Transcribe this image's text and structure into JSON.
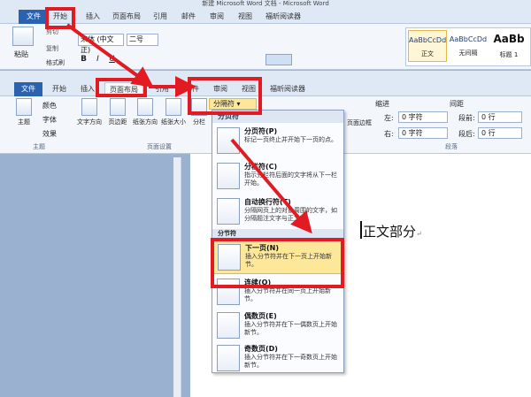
{
  "back_window": {
    "title": "新建 Microsoft Word 文档 - Microsoft Word",
    "tabs": [
      "文件",
      "开始",
      "插入",
      "页面布局",
      "引用",
      "邮件",
      "审阅",
      "视图",
      "福昕阅读器"
    ],
    "paste_label": "粘贴",
    "cut_label": "剪切",
    "copy_label": "复制",
    "format_painter_label": "格式刷",
    "font_name": "宋体 (中文正)",
    "font_size": "二号",
    "bold": "B",
    "italic": "I",
    "underline": "U",
    "styles": [
      {
        "preview": "AaBbCcDd",
        "name": "正文"
      },
      {
        "preview": "AaBbCcDd",
        "name": "无间隔"
      },
      {
        "preview": "AaBb",
        "name": "标题 1"
      }
    ]
  },
  "front_window": {
    "tabs": [
      "文件",
      "开始",
      "插入",
      "页面布局",
      "引用",
      "邮件",
      "审阅",
      "视图",
      "福昕阅读器"
    ],
    "ribbon": {
      "theme_group": "主题",
      "colors": "颜色",
      "fonts": "字体",
      "effects": "效果",
      "theme": "主题",
      "text_direction": "文字方向",
      "margins": "页边距",
      "orientation": "纸张方向",
      "size": "纸张大小",
      "columns": "分栏",
      "breaks_button": "分隔符",
      "page_setup_group": "页面设置",
      "page_border": "页面边框",
      "indent_label": "缩进",
      "spacing_label": "间距",
      "left_label": "左:",
      "right_label": "右:",
      "before_label": "段前:",
      "after_label": "段后:",
      "indent_left": "0 字符",
      "indent_right": "0 字符",
      "spacing_before": "0 行",
      "spacing_after": "0 行",
      "paragraph_group": "段落"
    }
  },
  "breaks_menu": {
    "header": "分页符",
    "items": [
      {
        "title": "分页符(P)",
        "desc": "标记一页终止并开始下一页的点。"
      },
      {
        "title": "分栏符(C)",
        "desc": "指示分栏符后面的文字将从下一栏开始。"
      },
      {
        "title": "自动换行符(T)",
        "desc": "分隔网页上的对象周围的文字，如分隔题注文字与正文。"
      },
      {
        "title": "分节符",
        "desc": ""
      },
      {
        "title": "下一页(N)",
        "desc": "插入分节符并在下一页上开始新节。"
      },
      {
        "title": "连续(O)",
        "desc": "插入分节符并在同一页上开始新节。"
      },
      {
        "title": "偶数页(E)",
        "desc": "插入分节符并在下一偶数页上开始新节。"
      },
      {
        "title": "奇数页(D)",
        "desc": "插入分节符并在下一奇数页上开始新节。"
      }
    ]
  },
  "document": {
    "text": "正文部分",
    "para_mark": "↵"
  },
  "colors": {
    "accent_red": "#e21a22",
    "file_tab": "#2a62b0",
    "highlight": "#fde89a"
  }
}
